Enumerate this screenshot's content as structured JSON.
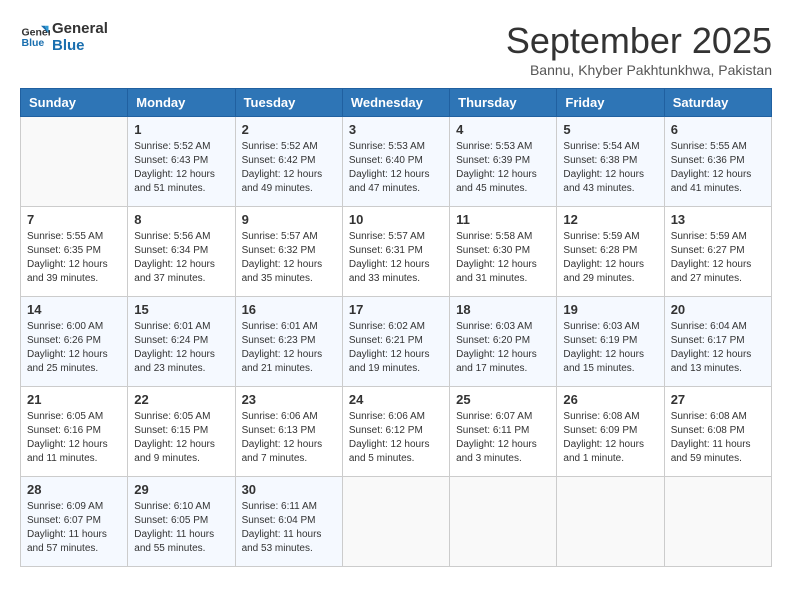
{
  "header": {
    "logo_line1": "General",
    "logo_line2": "Blue",
    "month": "September 2025",
    "location": "Bannu, Khyber Pakhtunkhwa, Pakistan"
  },
  "weekdays": [
    "Sunday",
    "Monday",
    "Tuesday",
    "Wednesday",
    "Thursday",
    "Friday",
    "Saturday"
  ],
  "weeks": [
    [
      {
        "day": "",
        "info": ""
      },
      {
        "day": "1",
        "info": "Sunrise: 5:52 AM\nSunset: 6:43 PM\nDaylight: 12 hours\nand 51 minutes."
      },
      {
        "day": "2",
        "info": "Sunrise: 5:52 AM\nSunset: 6:42 PM\nDaylight: 12 hours\nand 49 minutes."
      },
      {
        "day": "3",
        "info": "Sunrise: 5:53 AM\nSunset: 6:40 PM\nDaylight: 12 hours\nand 47 minutes."
      },
      {
        "day": "4",
        "info": "Sunrise: 5:53 AM\nSunset: 6:39 PM\nDaylight: 12 hours\nand 45 minutes."
      },
      {
        "day": "5",
        "info": "Sunrise: 5:54 AM\nSunset: 6:38 PM\nDaylight: 12 hours\nand 43 minutes."
      },
      {
        "day": "6",
        "info": "Sunrise: 5:55 AM\nSunset: 6:36 PM\nDaylight: 12 hours\nand 41 minutes."
      }
    ],
    [
      {
        "day": "7",
        "info": "Sunrise: 5:55 AM\nSunset: 6:35 PM\nDaylight: 12 hours\nand 39 minutes."
      },
      {
        "day": "8",
        "info": "Sunrise: 5:56 AM\nSunset: 6:34 PM\nDaylight: 12 hours\nand 37 minutes."
      },
      {
        "day": "9",
        "info": "Sunrise: 5:57 AM\nSunset: 6:32 PM\nDaylight: 12 hours\nand 35 minutes."
      },
      {
        "day": "10",
        "info": "Sunrise: 5:57 AM\nSunset: 6:31 PM\nDaylight: 12 hours\nand 33 minutes."
      },
      {
        "day": "11",
        "info": "Sunrise: 5:58 AM\nSunset: 6:30 PM\nDaylight: 12 hours\nand 31 minutes."
      },
      {
        "day": "12",
        "info": "Sunrise: 5:59 AM\nSunset: 6:28 PM\nDaylight: 12 hours\nand 29 minutes."
      },
      {
        "day": "13",
        "info": "Sunrise: 5:59 AM\nSunset: 6:27 PM\nDaylight: 12 hours\nand 27 minutes."
      }
    ],
    [
      {
        "day": "14",
        "info": "Sunrise: 6:00 AM\nSunset: 6:26 PM\nDaylight: 12 hours\nand 25 minutes."
      },
      {
        "day": "15",
        "info": "Sunrise: 6:01 AM\nSunset: 6:24 PM\nDaylight: 12 hours\nand 23 minutes."
      },
      {
        "day": "16",
        "info": "Sunrise: 6:01 AM\nSunset: 6:23 PM\nDaylight: 12 hours\nand 21 minutes."
      },
      {
        "day": "17",
        "info": "Sunrise: 6:02 AM\nSunset: 6:21 PM\nDaylight: 12 hours\nand 19 minutes."
      },
      {
        "day": "18",
        "info": "Sunrise: 6:03 AM\nSunset: 6:20 PM\nDaylight: 12 hours\nand 17 minutes."
      },
      {
        "day": "19",
        "info": "Sunrise: 6:03 AM\nSunset: 6:19 PM\nDaylight: 12 hours\nand 15 minutes."
      },
      {
        "day": "20",
        "info": "Sunrise: 6:04 AM\nSunset: 6:17 PM\nDaylight: 12 hours\nand 13 minutes."
      }
    ],
    [
      {
        "day": "21",
        "info": "Sunrise: 6:05 AM\nSunset: 6:16 PM\nDaylight: 12 hours\nand 11 minutes."
      },
      {
        "day": "22",
        "info": "Sunrise: 6:05 AM\nSunset: 6:15 PM\nDaylight: 12 hours\nand 9 minutes."
      },
      {
        "day": "23",
        "info": "Sunrise: 6:06 AM\nSunset: 6:13 PM\nDaylight: 12 hours\nand 7 minutes."
      },
      {
        "day": "24",
        "info": "Sunrise: 6:06 AM\nSunset: 6:12 PM\nDaylight: 12 hours\nand 5 minutes."
      },
      {
        "day": "25",
        "info": "Sunrise: 6:07 AM\nSunset: 6:11 PM\nDaylight: 12 hours\nand 3 minutes."
      },
      {
        "day": "26",
        "info": "Sunrise: 6:08 AM\nSunset: 6:09 PM\nDaylight: 12 hours\nand 1 minute."
      },
      {
        "day": "27",
        "info": "Sunrise: 6:08 AM\nSunset: 6:08 PM\nDaylight: 11 hours\nand 59 minutes."
      }
    ],
    [
      {
        "day": "28",
        "info": "Sunrise: 6:09 AM\nSunset: 6:07 PM\nDaylight: 11 hours\nand 57 minutes."
      },
      {
        "day": "29",
        "info": "Sunrise: 6:10 AM\nSunset: 6:05 PM\nDaylight: 11 hours\nand 55 minutes."
      },
      {
        "day": "30",
        "info": "Sunrise: 6:11 AM\nSunset: 6:04 PM\nDaylight: 11 hours\nand 53 minutes."
      },
      {
        "day": "",
        "info": ""
      },
      {
        "day": "",
        "info": ""
      },
      {
        "day": "",
        "info": ""
      },
      {
        "day": "",
        "info": ""
      }
    ]
  ]
}
